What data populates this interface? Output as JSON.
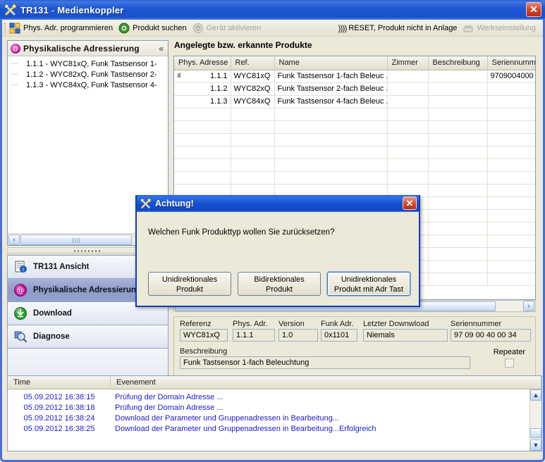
{
  "window": {
    "title_main": "TR131",
    "title_sep": " - ",
    "title_sub": "Medienkoppler",
    "close_label": "✕",
    "icon": "tools-icon"
  },
  "toolbar": {
    "items": [
      {
        "label": "Phys. Adr. programmieren",
        "icon": "blocks-icon",
        "disabled": false
      },
      {
        "label": "Produkt suchen",
        "icon": "target-icon",
        "disabled": false
      },
      {
        "label": "Gerät aktivieren",
        "icon": "power-icon",
        "disabled": true
      }
    ],
    "right_items": [
      {
        "label": "RESET, Produkt nicht in Anlage",
        "glyph": ")))) ",
        "disabled": false
      },
      {
        "label": "Werkseinstellung",
        "icon": "factory-icon",
        "disabled": true
      }
    ]
  },
  "tree_panel": {
    "title": "Physikalische Adressierung",
    "header_icon": "@",
    "collapse_label": "«",
    "nodes": [
      {
        "dash": "····",
        "label": "1.1.1 - WYC81xQ, Funk Tastsensor 1-"
      },
      {
        "dash": "····",
        "label": "1.1.2 - WYC82xQ, Funk Tastsensor 2-"
      },
      {
        "dash": "····",
        "label": "1.1.3 - WYC84xQ, Funk Tastsensor 4-"
      }
    ],
    "hscroll_left_label": "‹"
  },
  "nav": {
    "items": [
      {
        "label": "TR131 Ansicht",
        "icon": "document-info-icon",
        "active": false
      },
      {
        "label": "Physikalische Adressierun",
        "icon": "at-circle-icon",
        "active": true
      },
      {
        "label": "Download",
        "icon": "download-circle-icon",
        "active": false
      },
      {
        "label": "Diagnose",
        "icon": "magnifier-icon",
        "active": false
      }
    ]
  },
  "products": {
    "heading": "Angelegte bzw. erkannte Produkte",
    "columns": [
      "Phys. Adresse",
      "Ref.",
      "Name",
      "Zimmer",
      "Beschreibung",
      "Seriennumm"
    ],
    "rows": [
      {
        "marker": "⦂‖",
        "addr": "1.1.1",
        "ref": "WYC81xQ",
        "name": "Funk Tastsensor 1-fach Beleuc ...",
        "zimmer": "",
        "beschreibung": "",
        "serien": "9709004000"
      },
      {
        "marker": "",
        "addr": "1.1.2",
        "ref": "WYC82xQ",
        "name": "Funk Tastsensor 2-fach Beleuc ...",
        "zimmer": "",
        "beschreibung": "",
        "serien": ""
      },
      {
        "marker": "",
        "addr": "1.1.3",
        "ref": "WYC84xQ",
        "name": "Funk Tastsensor 4-fach Beleuc ...",
        "zimmer": "",
        "beschreibung": "",
        "serien": ""
      }
    ],
    "empty_rows": 14,
    "hscroll_right_label": "›"
  },
  "details": {
    "referenz_label": "Referenz",
    "referenz_value": "WYC81xQ",
    "phys_adr_label": "Phys. Adr.",
    "phys_adr_value": "1.1.1",
    "version_label": "Version",
    "version_value": "1.0",
    "funk_adr_label": "Funk Adr.",
    "funk_adr_value": "0x1101",
    "letzter_download_label": "Letzter Downwload",
    "letzter_download_value": "Niemals",
    "seriennummer_label": "Seriennummer",
    "seriennummer_value": "97 09 00 40 00 34",
    "beschreibung_label": "Beschreibung",
    "beschreibung_value": "Funk Tastsensor 1-fach Beleuchtung",
    "repeater_label": "Repeater",
    "repeater_checked": false
  },
  "log": {
    "columns": [
      "Time",
      "Evenement"
    ],
    "rows": [
      {
        "time": "05.09.2012 16:38:15",
        "event": "Prüfung der Domain Adresse ..."
      },
      {
        "time": "05.09.2012 16:38:18",
        "event": "Prüfung der Domain Adresse ..."
      },
      {
        "time": "05.09.2012 16:38:24",
        "event": "Download der Parameter und Gruppenadressen in Bearbeitung..."
      },
      {
        "time": "05.09.2012 16:38:25",
        "event": "Download der Parameter und Gruppenadressen in Bearbeitung...Erfolgreich"
      }
    ],
    "scroll_up_label": "▲",
    "scroll_down_label": "▼"
  },
  "dialog": {
    "title": "Achtung!",
    "icon": "tools-icon",
    "close_label": "✕",
    "message": "Welchen Funk Produkttyp wollen Sie zurücksetzen?",
    "buttons": [
      {
        "line1": "Unidirektionales",
        "line2": "Produkt",
        "focused": false
      },
      {
        "line1": "Bidirektionales",
        "line2": "Produkt",
        "focused": false
      },
      {
        "line1": "Unidirektionales",
        "line2": "Produkt  mit  Adr Tast",
        "focused": true
      }
    ]
  },
  "colors": {
    "title_blue": "#1551d0",
    "window_face": "#ece9d8",
    "log_text": "#1b1bc8",
    "accent_border": "#7f9db9"
  }
}
